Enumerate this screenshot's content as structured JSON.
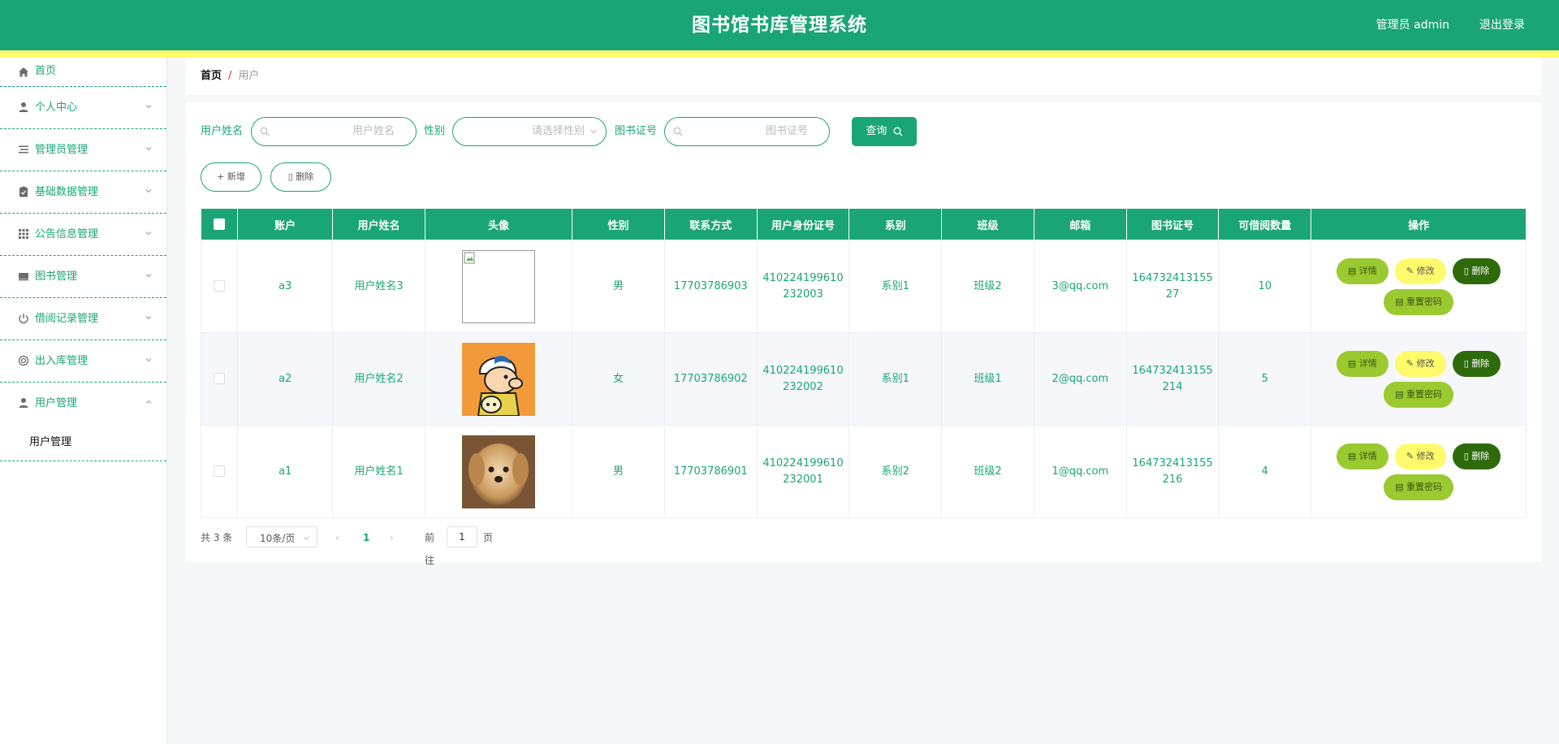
{
  "header": {
    "title": "图书馆书库管理系统",
    "user": "管理员 admin",
    "logout": "退出登录",
    "colors": {
      "primary": "#1aa576",
      "stripe": "#fdfa6b"
    }
  },
  "sidebar": {
    "items": [
      {
        "label": "首页",
        "icon": "home-icon"
      },
      {
        "label": "个人中心",
        "icon": "user-icon"
      },
      {
        "label": "管理员管理",
        "icon": "list-icon"
      },
      {
        "label": "基础数据管理",
        "icon": "clipboard-icon"
      },
      {
        "label": "公告信息管理",
        "icon": "grid-icon"
      },
      {
        "label": "图书管理",
        "icon": "book-icon"
      },
      {
        "label": "借阅记录管理",
        "icon": "power-icon"
      },
      {
        "label": "出入库管理",
        "icon": "circle-icon"
      },
      {
        "label": "用户管理",
        "icon": "user-icon"
      }
    ],
    "submenu": {
      "label": "用户管理"
    }
  },
  "breadcrumb": {
    "home": "首页",
    "separator": "/",
    "current": "用户"
  },
  "search": {
    "name_label": "用户姓名",
    "name_placeholder": "用户姓名",
    "gender_label": "性别",
    "gender_placeholder": "请选择性别",
    "card_label": "图书证号",
    "card_placeholder": "图书证号",
    "query_button": "查询"
  },
  "actions": {
    "add": "新增",
    "delete": "删除"
  },
  "table": {
    "headers": [
      "账户",
      "用户姓名",
      "头像",
      "性别",
      "联系方式",
      "用户身份证号",
      "系别",
      "班级",
      "邮箱",
      "图书证号",
      "可借阅数量",
      "操作"
    ],
    "rows": [
      {
        "account": "a3",
        "name": "用户姓名3",
        "avatar": "broken-image",
        "gender": "男",
        "phone": "17703786903",
        "id_l1": "410224199610",
        "id_l2": "232003",
        "dept": "系别1",
        "class": "班级2",
        "email": "3@qq.com",
        "card_l1": "164732413155",
        "card_l2": "27",
        "quota": "10"
      },
      {
        "account": "a2",
        "name": "用户姓名2",
        "avatar": "cartoon-boy",
        "gender": "女",
        "phone": "17703786902",
        "id_l1": "410224199610",
        "id_l2": "232002",
        "dept": "系别1",
        "class": "班级1",
        "email": "2@qq.com",
        "card_l1": "164732413155",
        "card_l2": "214",
        "quota": "5"
      },
      {
        "account": "a1",
        "name": "用户姓名1",
        "avatar": "puppy-photo",
        "gender": "男",
        "phone": "17703786901",
        "id_l1": "410224199610",
        "id_l2": "232001",
        "dept": "系别2",
        "class": "班级2",
        "email": "1@qq.com",
        "card_l1": "164732413155",
        "card_l2": "216",
        "quota": "4"
      }
    ],
    "ops": {
      "detail": "详情",
      "edit": "修改",
      "delete": "删除",
      "reset": "重置密码"
    }
  },
  "pagination": {
    "total": "共 3 条",
    "page_size": "10条/页",
    "current": "1",
    "goto_label": "前往",
    "goto_value": "1",
    "goto_unit": "页"
  }
}
